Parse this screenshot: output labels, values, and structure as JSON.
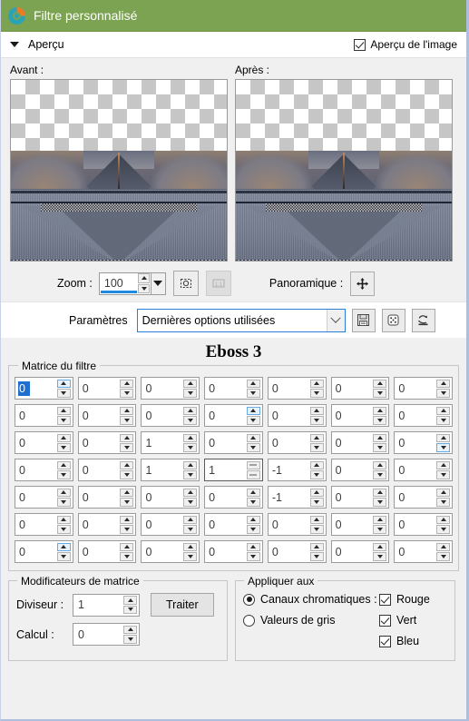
{
  "window": {
    "title": "Filtre personnalisé",
    "icon": "paintshop-logo-icon",
    "titlebar_color": "#7ba351"
  },
  "preview_section": {
    "toggle_label": "Aperçu",
    "toggle_icon": "triangle-down-icon",
    "image_preview_checkbox": {
      "label": "Aperçu de l'image",
      "checked": true
    },
    "before_label": "Avant :",
    "after_label": "Après :"
  },
  "zoom_bar": {
    "zoom_label": "Zoom :",
    "zoom_value": "100",
    "fit_button_icon": "fit-to-window-icon",
    "actual_size_button_icon": "one-to-one-icon",
    "actual_size_disabled": true,
    "pan_label": "Panoramique :",
    "pan_button_icon": "move-cursor-icon"
  },
  "parameters": {
    "label": "Paramètres",
    "selected": "Dernières options utilisées",
    "dropdown_icon": "chevron-down-icon",
    "buttons": [
      {
        "name": "save-preset-button",
        "icon": "floppy-disk-icon"
      },
      {
        "name": "randomize-button",
        "icon": "dice-icon"
      },
      {
        "name": "reset-button",
        "icon": "reset-arrow-icon"
      }
    ]
  },
  "preset_title": "Eboss 3",
  "matrix_group": {
    "legend": "Matrice du filtre",
    "rows": [
      [
        "0",
        "0",
        "0",
        "0",
        "0",
        "0",
        "0"
      ],
      [
        "0",
        "0",
        "0",
        "0",
        "0",
        "0",
        "0"
      ],
      [
        "0",
        "0",
        "1",
        "0",
        "0",
        "0",
        "0"
      ],
      [
        "0",
        "0",
        "1",
        "1",
        "-1",
        "0",
        "0"
      ],
      [
        "0",
        "0",
        "0",
        "0",
        "-1",
        "0",
        "0"
      ],
      [
        "0",
        "0",
        "0",
        "0",
        "0",
        "0",
        "0"
      ],
      [
        "0",
        "0",
        "0",
        "0",
        "0",
        "0",
        "0"
      ]
    ],
    "selected_cell": {
      "row": 0,
      "col": 0
    },
    "focused_cell": {
      "row": 3,
      "col": 3
    }
  },
  "modifiers_group": {
    "legend": "Modificateurs de matrice",
    "divisor_label": "Diviseur :",
    "divisor_value": "1",
    "calc_label": "Calcul :",
    "calc_value": "0",
    "process_button": "Traiter"
  },
  "apply_group": {
    "legend": "Appliquer aux",
    "options": [
      {
        "label": "Canaux chromatiques :",
        "selected": true
      },
      {
        "label": "Valeurs de gris",
        "selected": false
      }
    ],
    "channels": [
      {
        "label": "Rouge",
        "checked": true
      },
      {
        "label": "Vert",
        "checked": true
      },
      {
        "label": "Bleu",
        "checked": true
      }
    ]
  }
}
